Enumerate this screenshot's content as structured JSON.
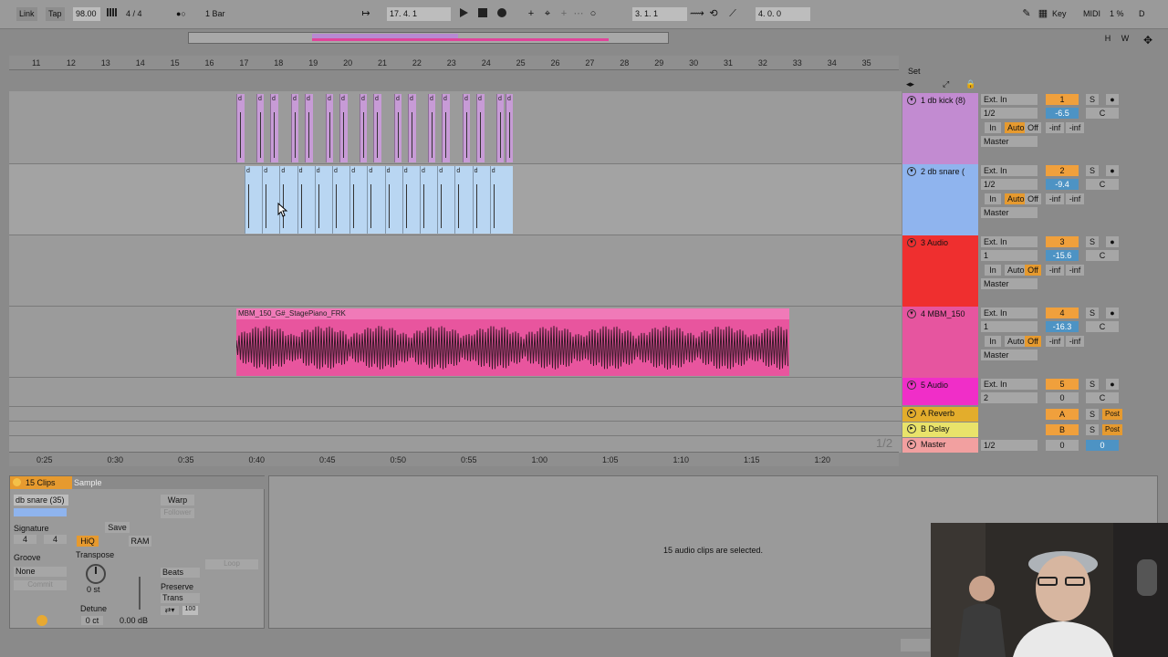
{
  "topbar": {
    "link": "Link",
    "tap": "Tap",
    "tempo": "98.00",
    "meter_icon": "meter-icon",
    "signature": "4 / 4",
    "metro_dots": "●○",
    "quantize": "1 Bar",
    "position": "17.   4.   1",
    "loop_start": "3.   1.   1",
    "loop_length": "4.   0.   0",
    "key": "Key",
    "midi": "MIDI",
    "cpu": "1 %",
    "disk": "D"
  },
  "ruler": [
    "11",
    "12",
    "13",
    "14",
    "15",
    "16",
    "17",
    "18",
    "19",
    "20",
    "21",
    "22",
    "23",
    "24",
    "25",
    "26",
    "27",
    "28",
    "29",
    "30",
    "31",
    "32",
    "33",
    "34",
    "35"
  ],
  "set_label": "Set",
  "time_ruler": [
    "0:25",
    "0:30",
    "0:35",
    "0:40",
    "0:45",
    "0:50",
    "0:55",
    "1:00",
    "1:05",
    "1:10",
    "1:15",
    "1:20"
  ],
  "page_indicator": "1/2",
  "tracks": [
    {
      "name": "1 db kick (8)",
      "input": "Ext. In",
      "ch": "1/2",
      "num": "1",
      "vol": "-6.5",
      "pan": "C",
      "out": "Master",
      "color": "#c28bd1",
      "mon": [
        "In",
        "Auto",
        "Off"
      ],
      "sends": [
        "-inf",
        "-inf"
      ],
      "monitor_active": "Auto"
    },
    {
      "name": "2 db snare (",
      "input": "Ext. In",
      "ch": "1/2",
      "num": "2",
      "vol": "-9.4",
      "pan": "C",
      "out": "Master",
      "color": "#8fb4ee",
      "mon": [
        "In",
        "Auto",
        "Off"
      ],
      "sends": [
        "-inf",
        "-inf"
      ],
      "monitor_active": "Auto"
    },
    {
      "name": "3 Audio",
      "input": "Ext. In",
      "ch": "1",
      "num": "3",
      "vol": "-15.6",
      "pan": "C",
      "out": "Master",
      "color": "#ef2f2f",
      "mon": [
        "In",
        "Auto",
        "Off"
      ],
      "sends": [
        "-inf",
        "-inf"
      ],
      "monitor_active": "Off"
    },
    {
      "name": "4 MBM_150",
      "input": "Ext. In",
      "ch": "1",
      "num": "4",
      "vol": "-16.3",
      "pan": "C",
      "out": "Master",
      "color": "#e6559f",
      "mon": [
        "In",
        "Auto",
        "Off"
      ],
      "sends": [
        "-inf",
        "-inf"
      ],
      "monitor_active": "Off"
    },
    {
      "name": "5 Audio",
      "input": "Ext. In",
      "ch": "2",
      "num": "5",
      "vol": "0",
      "pan": "C",
      "color": "#f02ec8"
    }
  ],
  "returns": [
    {
      "name": "A Reverb",
      "num": "A",
      "color": "#e3ad2c"
    },
    {
      "name": "B Delay",
      "num": "B",
      "color": "#e9e36a"
    },
    {
      "name": "Master",
      "ch": "1/2",
      "num": "0",
      "vol": "0",
      "color": "#f2a0a0"
    }
  ],
  "solo_label": "S",
  "post_label": "Post",
  "clip_name_piano": "MBM_150_G#_StagePiano_FRK",
  "kick_tick_label": "d",
  "detail": {
    "clips_count": "15 Clips",
    "sample_tab": "Sample",
    "clip_name": "db snare (35)",
    "signature_label": "Signature",
    "sig_num": "4",
    "sig_den": "4",
    "groove_label": "Groove",
    "groove_value": "None",
    "commit": "Commit",
    "save": "Save",
    "hiq": "HiQ",
    "ram": "RAM",
    "transpose": "Transpose",
    "transpose_value": "0 st",
    "detune": "Detune",
    "detune_value": "0 ct",
    "gain_value": "0.00 dB",
    "warp": "Warp",
    "follower": "Follower",
    "beats": "Beats",
    "preserve": "Preserve",
    "trans": "Trans",
    "loop": "Loop",
    "grain": "100",
    "selected_msg": "15 audio clips are selected."
  }
}
